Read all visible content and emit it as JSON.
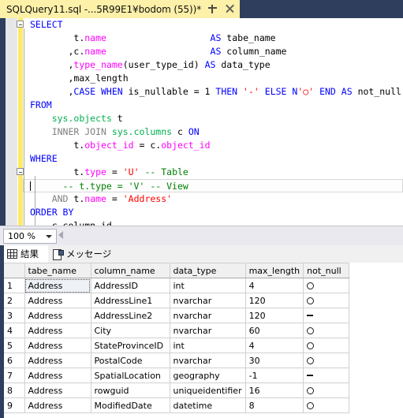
{
  "window": {
    "tab": {
      "title": "SQLQuery11.sql -...5R99E1¥bodom (55))*",
      "pin_icon": "pin-icon",
      "close_icon": "close-icon"
    }
  },
  "editor": {
    "zoom_level": "100 %",
    "lines": [
      {
        "id": 1,
        "outline": "collapse",
        "tokens": [
          {
            "t": "SELECT",
            "c": "kw"
          }
        ]
      },
      {
        "id": 2,
        "tokens": [
          {
            "t": "        t",
            "c": "blk"
          },
          {
            "t": ".",
            "c": "blk"
          },
          {
            "t": "name",
            "c": "pnk"
          },
          {
            "t": "                   ",
            "c": "blk"
          },
          {
            "t": "AS",
            "c": "kw"
          },
          {
            "t": " tabe_name",
            "c": "blk"
          }
        ]
      },
      {
        "id": 3,
        "tokens": [
          {
            "t": "       ,c",
            "c": "blk"
          },
          {
            "t": ".",
            "c": "blk"
          },
          {
            "t": "name",
            "c": "pnk"
          },
          {
            "t": "                   ",
            "c": "blk"
          },
          {
            "t": "AS",
            "c": "kw"
          },
          {
            "t": " column_name",
            "c": "blk"
          }
        ]
      },
      {
        "id": 4,
        "tokens": [
          {
            "t": "       ,",
            "c": "blk"
          },
          {
            "t": "type_name",
            "c": "fn"
          },
          {
            "t": "(user_type_id) ",
            "c": "blk"
          },
          {
            "t": "AS",
            "c": "kw"
          },
          {
            "t": " data_type",
            "c": "blk"
          }
        ]
      },
      {
        "id": 5,
        "tokens": [
          {
            "t": "       ,max_length",
            "c": "blk"
          }
        ]
      },
      {
        "id": 6,
        "tokens": [
          {
            "t": "       ,",
            "c": "blk"
          },
          {
            "t": "CASE WHEN",
            "c": "kw"
          },
          {
            "t": " is_nullable = 1 ",
            "c": "blk"
          },
          {
            "t": "THEN",
            "c": "kw"
          },
          {
            "t": " ",
            "c": "blk"
          },
          {
            "t": "'-'",
            "c": "str"
          },
          {
            "t": " ",
            "c": "blk"
          },
          {
            "t": "ELSE",
            "c": "kw"
          },
          {
            "t": " ",
            "c": "blk"
          },
          {
            "t": "N",
            "c": "kw"
          },
          {
            "t": "'○'",
            "c": "str"
          },
          {
            "t": " ",
            "c": "blk"
          },
          {
            "t": "END",
            "c": "kw"
          },
          {
            "t": " ",
            "c": "blk"
          },
          {
            "t": "AS",
            "c": "kw"
          },
          {
            "t": " not_null",
            "c": "blk"
          }
        ]
      },
      {
        "id": 7,
        "tokens": [
          {
            "t": "FROM",
            "c": "kw"
          }
        ]
      },
      {
        "id": 8,
        "tokens": [
          {
            "t": "    ",
            "c": "blk"
          },
          {
            "t": "sys.objects",
            "c": "grn"
          },
          {
            "t": " t",
            "c": "blk"
          }
        ]
      },
      {
        "id": 9,
        "tokens": [
          {
            "t": "    ",
            "c": "blk"
          },
          {
            "t": "INNER JOIN",
            "c": "kwg"
          },
          {
            "t": " ",
            "c": "blk"
          },
          {
            "t": "sys.columns",
            "c": "grn"
          },
          {
            "t": " c ",
            "c": "blk"
          },
          {
            "t": "ON",
            "c": "kw"
          }
        ]
      },
      {
        "id": 10,
        "tokens": [
          {
            "t": "        t.",
            "c": "blk"
          },
          {
            "t": "object_id",
            "c": "pnk"
          },
          {
            "t": " = c.",
            "c": "blk"
          },
          {
            "t": "object_id",
            "c": "pnk"
          }
        ]
      },
      {
        "id": 11,
        "tokens": [
          {
            "t": "WHERE",
            "c": "kw"
          }
        ]
      },
      {
        "id": 12,
        "outline": "collapse",
        "tokens": [
          {
            "t": "        t.",
            "c": "blk"
          },
          {
            "t": "type",
            "c": "pnk"
          },
          {
            "t": " = ",
            "c": "blk"
          },
          {
            "t": "'U'",
            "c": "str"
          },
          {
            "t": " ",
            "c": "blk"
          },
          {
            "t": "-- Table",
            "c": "cmt"
          }
        ]
      },
      {
        "id": 13,
        "current": true,
        "caret": true,
        "tokens": [
          {
            "t": "      ",
            "c": "blk"
          },
          {
            "t": "-- t.type = 'V' -- View",
            "c": "cmt"
          }
        ]
      },
      {
        "id": 14,
        "tokens": [
          {
            "t": "    ",
            "c": "blk"
          },
          {
            "t": "AND",
            "c": "kwg"
          },
          {
            "t": " t.",
            "c": "blk"
          },
          {
            "t": "name",
            "c": "pnk"
          },
          {
            "t": " = ",
            "c": "blk"
          },
          {
            "t": "'Address'",
            "c": "str"
          }
        ]
      },
      {
        "id": 15,
        "tokens": [
          {
            "t": "ORDER BY",
            "c": "kw"
          }
        ]
      },
      {
        "id": 16,
        "tokens": [
          {
            "t": "    c.column_id",
            "c": "blk"
          }
        ]
      }
    ]
  },
  "results": {
    "tabs": [
      {
        "label": "結果",
        "icon": "grid-icon",
        "active": true
      },
      {
        "label": "メッセージ",
        "icon": "msg-icon",
        "active": false
      }
    ],
    "columns": [
      "tabe_name",
      "column_name",
      "data_type",
      "max_length",
      "not_null"
    ],
    "rows": [
      {
        "n": "1",
        "tabe_name": "Address",
        "column_name": "AddressID",
        "data_type": "int",
        "max_length": "4",
        "not_null": "circle",
        "focused": true
      },
      {
        "n": "2",
        "tabe_name": "Address",
        "column_name": "AddressLine1",
        "data_type": "nvarchar",
        "max_length": "120",
        "not_null": "circle",
        "focused": false
      },
      {
        "n": "3",
        "tabe_name": "Address",
        "column_name": "AddressLine2",
        "data_type": "nvarchar",
        "max_length": "120",
        "not_null": "dash",
        "focused": false
      },
      {
        "n": "4",
        "tabe_name": "Address",
        "column_name": "City",
        "data_type": "nvarchar",
        "max_length": "60",
        "not_null": "circle",
        "focused": false
      },
      {
        "n": "5",
        "tabe_name": "Address",
        "column_name": "StateProvinceID",
        "data_type": "int",
        "max_length": "4",
        "not_null": "circle",
        "focused": false
      },
      {
        "n": "6",
        "tabe_name": "Address",
        "column_name": "PostalCode",
        "data_type": "nvarchar",
        "max_length": "30",
        "not_null": "circle",
        "focused": false
      },
      {
        "n": "7",
        "tabe_name": "Address",
        "column_name": "SpatialLocation",
        "data_type": "geography",
        "max_length": "-1",
        "not_null": "dash",
        "focused": false
      },
      {
        "n": "8",
        "tabe_name": "Address",
        "column_name": "rowguid",
        "data_type": "uniqueidentifier",
        "max_length": "16",
        "not_null": "circle",
        "focused": false
      },
      {
        "n": "9",
        "tabe_name": "Address",
        "column_name": "ModifiedDate",
        "data_type": "datetime",
        "max_length": "8",
        "not_null": "circle",
        "focused": false
      }
    ]
  },
  "colors": {
    "chrome": "#2e3e5c",
    "tab_active": "#fdf0a8",
    "change_bar": "#fbeb67",
    "keyword": "#0000ff",
    "string": "#ff0000",
    "comment": "#008000",
    "function": "#ff00ff",
    "schema_object": "#00b050",
    "keyword_gray": "#808080"
  }
}
